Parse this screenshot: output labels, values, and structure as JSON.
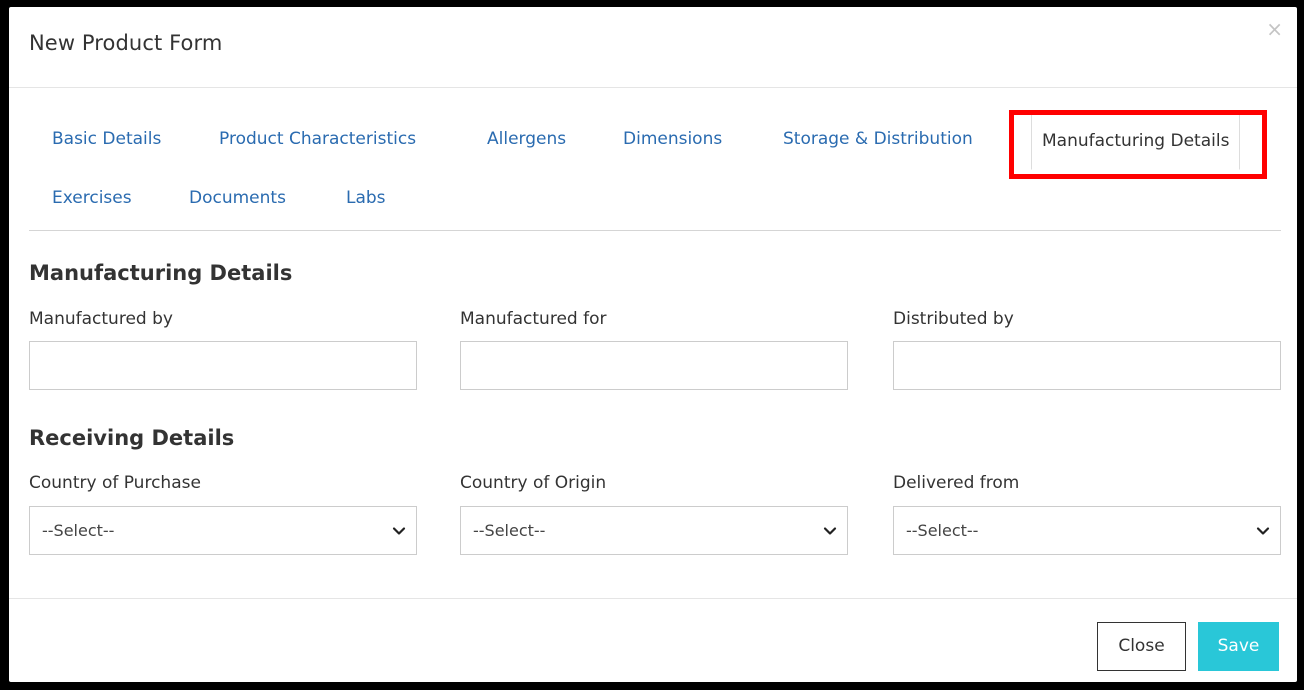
{
  "modal": {
    "title": "New Product Form",
    "close_icon": "×"
  },
  "tabs": [
    {
      "label": "Basic Details"
    },
    {
      "label": "Product Characteristics"
    },
    {
      "label": "Allergens"
    },
    {
      "label": "Dimensions"
    },
    {
      "label": "Storage & Distribution"
    },
    {
      "label": "Manufacturing Details",
      "active": true
    },
    {
      "label": "Exercises"
    },
    {
      "label": "Documents"
    },
    {
      "label": "Labs"
    }
  ],
  "manufacturing": {
    "title": "Manufacturing Details",
    "fields": [
      {
        "label": "Manufactured by",
        "value": ""
      },
      {
        "label": "Manufactured for",
        "value": ""
      },
      {
        "label": "Distributed by",
        "value": ""
      }
    ]
  },
  "receiving": {
    "title": "Receiving Details",
    "fields": [
      {
        "label": "Country of Purchase",
        "selected": "--Select--"
      },
      {
        "label": "Country of Origin",
        "selected": "--Select--"
      },
      {
        "label": "Delivered from",
        "selected": "--Select--"
      }
    ]
  },
  "footer": {
    "close_label": "Close",
    "save_label": "Save"
  },
  "colors": {
    "link": "#2a6bb0",
    "highlight": "#ff0000",
    "save_button": "#29c7d8"
  }
}
